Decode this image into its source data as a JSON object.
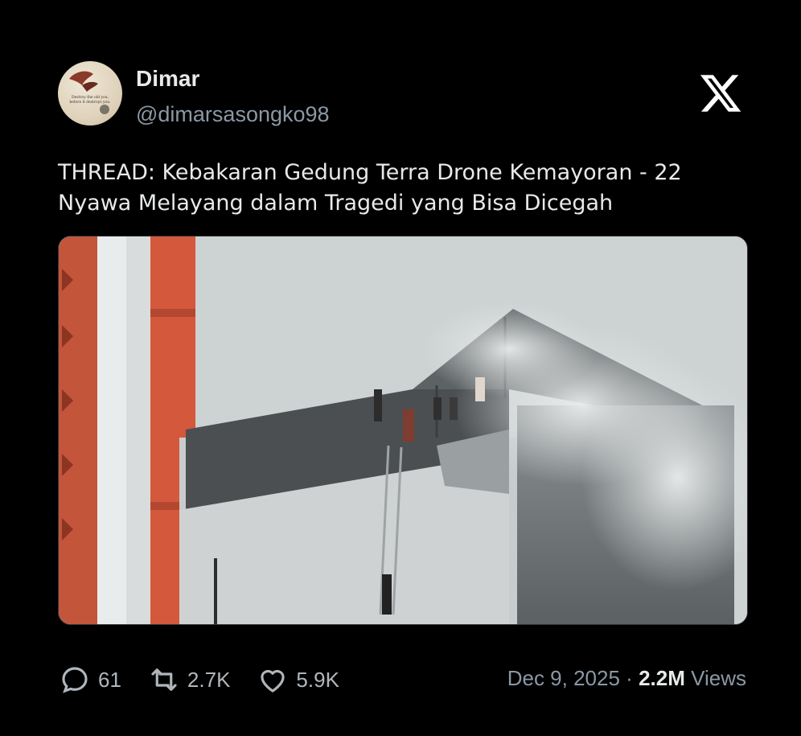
{
  "author": {
    "display_name": "Dimar",
    "handle": "@dimarsasongko98",
    "avatar_caption_line1": "Destroy the old you,",
    "avatar_caption_line2": "before it destroys you."
  },
  "tweet": {
    "text_line1": "THREAD: Kebakaran Gedung Terra Drone Kemayoran - 22",
    "text_line2": "Nyawa Melayang dalam Tragedi yang Bisa Dicegah"
  },
  "stats": {
    "replies": "61",
    "reposts": "2.7K",
    "likes": "5.9K"
  },
  "meta": {
    "date": "Dec 9, 2025",
    "separator": "·",
    "views_count": "2.2M",
    "views_label": "Views"
  },
  "icons": {
    "logo": "x-logo-icon",
    "reply": "speech-bubble-icon",
    "repost": "repost-arrows-icon",
    "like": "heart-icon"
  },
  "colors": {
    "background": "#000000",
    "text": "#e7e9ea",
    "muted": "#8b98a5"
  }
}
